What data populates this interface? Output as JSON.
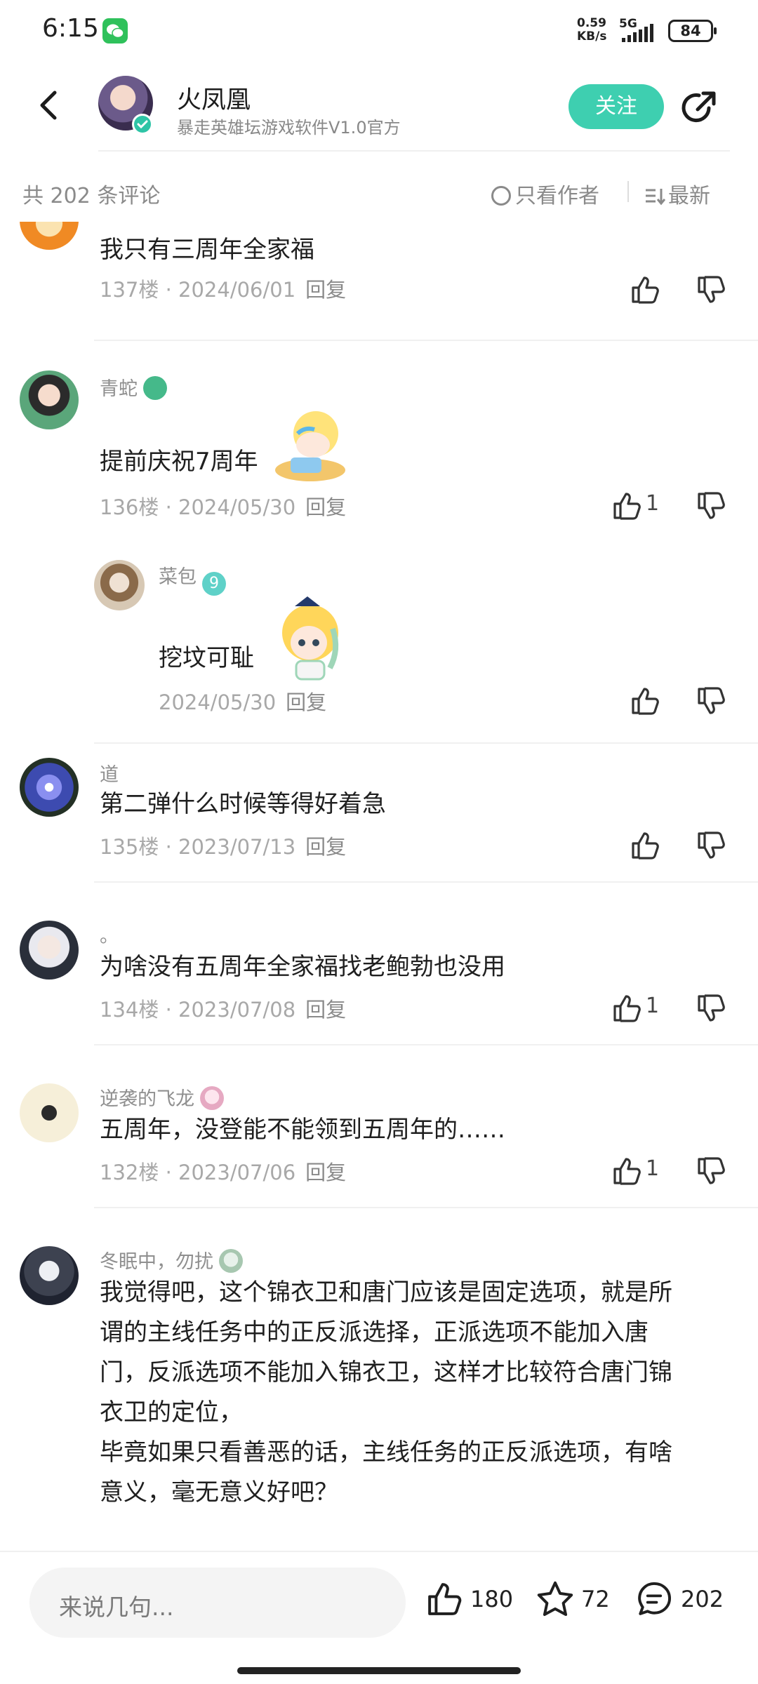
{
  "status_bar": {
    "time": "6:15",
    "net_speed_value": "0.59",
    "net_speed_unit": "KB/s",
    "signal_label": "5G",
    "battery": "84"
  },
  "header": {
    "author_name": "火凤凰",
    "author_subtitle": "暴走英雄坛游戏软件V1.0官方",
    "follow_label": "关注"
  },
  "sort_bar": {
    "comment_count": "共 202 条评论",
    "author_only_label": "只看作者",
    "sort_label": "最新"
  },
  "comments": [
    {
      "text": "我只有三周年全家福",
      "floor": "137楼",
      "date": "2024/06/01",
      "reply_label": "回复"
    },
    {
      "user": "青蛇",
      "text": "提前庆祝7周年",
      "floor": "136楼",
      "date": "2024/05/30",
      "reply_label": "回复",
      "likes": "1",
      "reply": {
        "user": "菜包",
        "level": "9",
        "text": "挖坟可耻",
        "date": "2024/05/30",
        "reply_label": "回复"
      }
    },
    {
      "user": "道",
      "text": "第二弹什么时候等得好着急",
      "floor": "135楼",
      "date": "2023/07/13",
      "reply_label": "回复"
    },
    {
      "user": "。",
      "text": "为啥没有五周年全家福找老鲍勃也没用",
      "floor": "134楼",
      "date": "2023/07/08",
      "reply_label": "回复",
      "likes": "1"
    },
    {
      "user": "逆袭的飞龙",
      "text": "五周年，没登能不能领到五周年的……",
      "floor": "132楼",
      "date": "2023/07/06",
      "reply_label": "回复",
      "likes": "1"
    },
    {
      "user": "冬眠中，勿扰",
      "text_lines": [
        "我觉得吧，这个锦衣卫和唐门应该是固定选项，就是所",
        "谓的主线任务中的正反派选择，正派选项不能加入唐",
        "门，反派选项不能加入锦衣卫，这样才比较符合唐门锦",
        "衣卫的定位，",
        "毕竟如果只看善恶的话，主线任务的正反派选项，有啥",
        "意义，毫无意义好吧？"
      ]
    }
  ],
  "bottom_bar": {
    "input_placeholder": "来说几句...",
    "like_count": "180",
    "favorite_count": "72",
    "comment_count": "202"
  },
  "colors": {
    "accent": "#3ecfb0",
    "text_primary": "#1f1f1f",
    "text_secondary": "#8f8f8f"
  }
}
